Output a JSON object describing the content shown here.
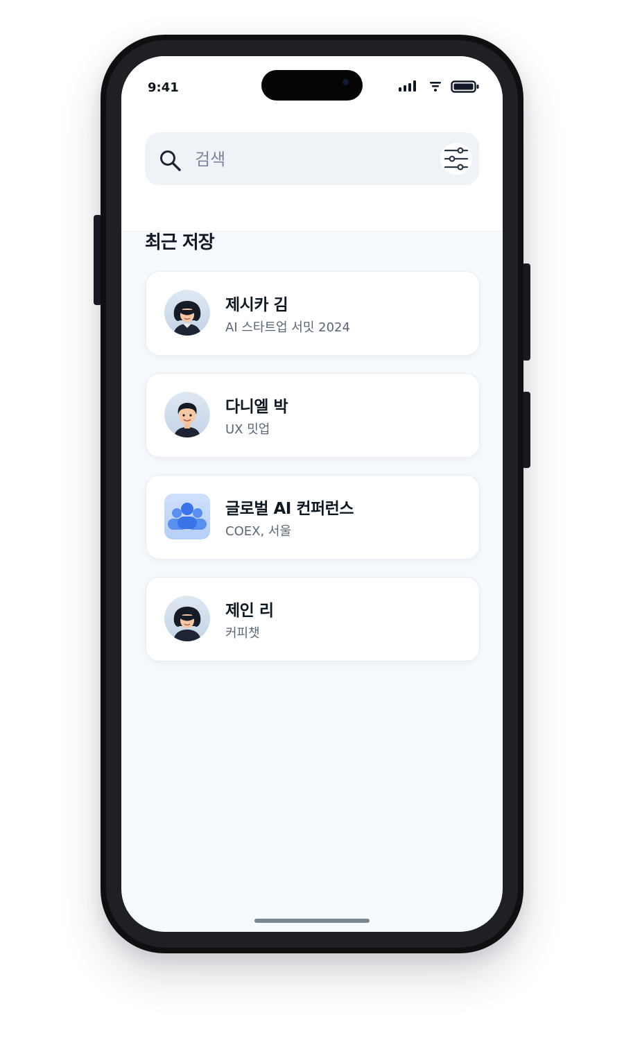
{
  "status_bar": {
    "time": "9:41",
    "icons": [
      "cellular-signal-icon",
      "wifi-icon",
      "battery-icon"
    ]
  },
  "search": {
    "placeholder": "검색",
    "value": ""
  },
  "section": {
    "title": "최근 저장"
  },
  "contacts": [
    {
      "name": "제시카 김",
      "subtitle": "AI 스타트업 서밋 2024",
      "avatar": "woman-avatar"
    },
    {
      "name": "다니엘 박",
      "subtitle": "UX 밋업",
      "avatar": "man-avatar"
    },
    {
      "name": "글로벌 AI 컨퍼런스",
      "subtitle": "COEX, 서울",
      "avatar": "group-icon"
    },
    {
      "name": "제인 리",
      "subtitle": "커피챗",
      "avatar": "woman-avatar"
    }
  ],
  "colors": {
    "screen_bg": "#f6f9fd",
    "search_bg": "#eff3f8",
    "accent_blue": "#3b74e8",
    "text_primary": "#0f1720",
    "text_secondary": "#5b6574"
  }
}
